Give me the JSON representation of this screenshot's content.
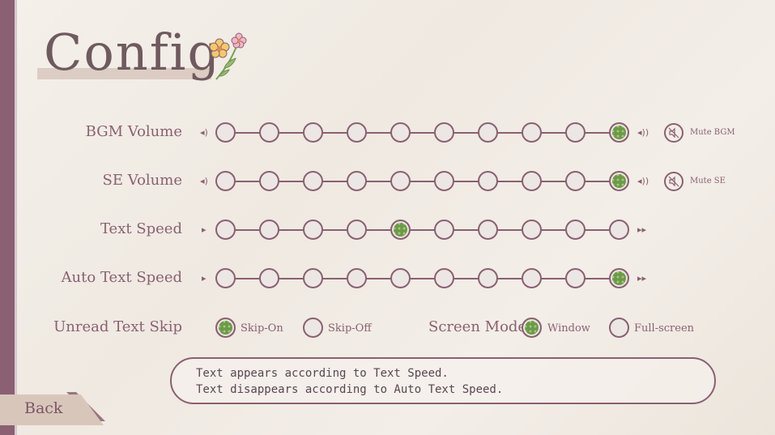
{
  "title": "Config",
  "rows": {
    "bgm": {
      "label": "BGM Volume",
      "level": 10,
      "mute_label": "Mute BGM"
    },
    "se": {
      "label": "SE Volume",
      "level": 10,
      "mute_label": "Mute SE"
    },
    "text_speed": {
      "label": "Text Speed",
      "level": 5
    },
    "auto_text_speed": {
      "label": "Auto Text Speed",
      "level": 10
    }
  },
  "unread_skip": {
    "label": "Unread Text Skip",
    "options": [
      "Skip-On",
      "Skip-Off"
    ],
    "selected": "Skip-On"
  },
  "screen_mode": {
    "label": "Screen Mode",
    "options": [
      "Window",
      "Full-screen"
    ],
    "selected": "Window"
  },
  "info_text": {
    "line1": "Text appears according to Text Speed.",
    "line2": "Text disappears according to Auto Text Speed."
  },
  "back_label": "Back",
  "colors": {
    "accent": "#8a6072",
    "selected_dot": "#6d9a4a"
  }
}
